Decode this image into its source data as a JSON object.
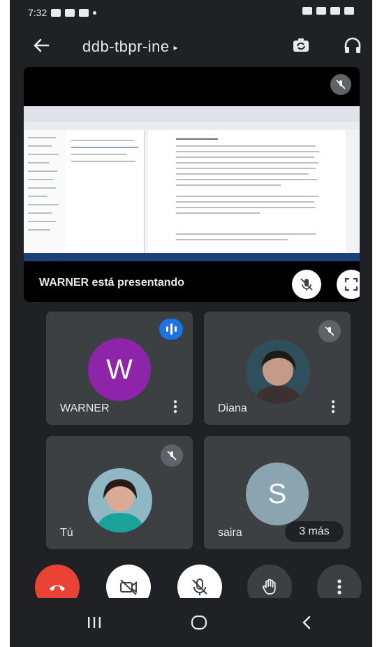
{
  "status_bar": {
    "time": "7:32"
  },
  "topbar": {
    "meeting_code": "ddb-tbpr-ine",
    "caret": "▸"
  },
  "presentation": {
    "label": "WARNER está presentando"
  },
  "participants": [
    {
      "name": "WARNER",
      "initial": "W",
      "avatar_color": "#8e24aa"
    },
    {
      "name": "Diana"
    },
    {
      "name": "Tú"
    },
    {
      "name": "saira",
      "initial": "S",
      "avatar_color": "#8aa4b0"
    }
  ],
  "overflow": {
    "label": "3 más"
  },
  "colors": {
    "background": "#202124",
    "tile": "#3c4043",
    "end_call": "#ea4335",
    "speaking": "#1a73e8"
  },
  "icons": {
    "back": "arrow-left-icon",
    "switch_camera": "switch-camera-icon",
    "audio": "headphones-icon",
    "mic_off": "mic-off-icon",
    "fullscreen": "fullscreen-icon",
    "more": "more-vert-icon",
    "end_call": "call-end-icon",
    "camera_off": "videocam-off-icon",
    "hand": "hand-raise-icon"
  }
}
